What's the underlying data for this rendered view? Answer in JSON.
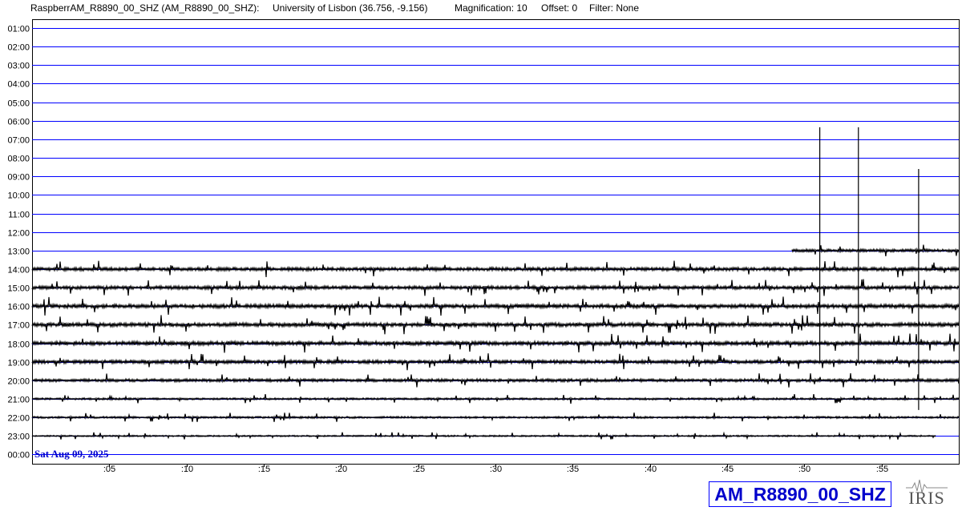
{
  "header": {
    "station": "RaspberrAM_R8890_00_SHZ (AM_R8890_00_SHZ):",
    "location": "University of Lisbon (36.756, -9.156)",
    "magnification": "Magnification: 10",
    "offset": "Offset: 0",
    "filter": "Filter: None"
  },
  "date_label": "Sat Aug 09, 2025",
  "station_code": "AM_R8890_00_SHZ",
  "logo_text": "IRIS",
  "colors": {
    "grid": "#0000ff",
    "trace": "#000000",
    "label": "#0000cc",
    "axis_text": "#000000"
  },
  "chart_data": {
    "type": "line",
    "title": "",
    "xlabel": "",
    "ylabel": "",
    "rows": [
      "01:00",
      "02:00",
      "03:00",
      "04:00",
      "05:00",
      "06:00",
      "07:00",
      "08:00",
      "09:00",
      "10:00",
      "11:00",
      "12:00",
      "13:00",
      "14:00",
      "15:00",
      "16:00",
      "17:00",
      "18:00",
      "19:00",
      "20:00",
      "21:00",
      "22:00",
      "23:00",
      "00:00"
    ],
    "x_ticks": [
      ":05",
      ":10",
      ":15",
      ":20",
      ":25",
      ":30",
      ":35",
      ":40",
      ":45",
      ":50",
      ":55"
    ],
    "x_tick_minutes": [
      5,
      10,
      15,
      20,
      25,
      30,
      35,
      40,
      45,
      50,
      55
    ],
    "xlim": [
      0,
      60
    ],
    "traces": [
      {
        "row": "13:00",
        "start_min": 49.2,
        "end_min": 60,
        "amplitude": 0.3
      },
      {
        "row": "14:00",
        "start_min": 0,
        "end_min": 60,
        "amplitude": 0.35
      },
      {
        "row": "15:00",
        "start_min": 0,
        "end_min": 60,
        "amplitude": 0.35
      },
      {
        "row": "16:00",
        "start_min": 0,
        "end_min": 60,
        "amplitude": 0.4
      },
      {
        "row": "17:00",
        "start_min": 0,
        "end_min": 60,
        "amplitude": 0.4
      },
      {
        "row": "18:00",
        "start_min": 0,
        "end_min": 60,
        "amplitude": 0.4
      },
      {
        "row": "19:00",
        "start_min": 0,
        "end_min": 60,
        "amplitude": 0.35
      },
      {
        "row": "20:00",
        "start_min": 0,
        "end_min": 60,
        "amplitude": 0.3
      },
      {
        "row": "21:00",
        "start_min": 0,
        "end_min": 60,
        "amplitude": 0.2
      },
      {
        "row": "22:00",
        "start_min": 0,
        "end_min": 60,
        "amplitude": 0.2
      },
      {
        "row": "23:00",
        "start_min": 0,
        "end_min": 58.5,
        "amplitude": 0.15
      }
    ],
    "spikes": [
      {
        "row": "13:00",
        "minute": 51.0,
        "top_row_value": 6.35,
        "bottom_row_value": 19.0
      },
      {
        "row": "13:00",
        "minute": 53.5,
        "top_row_value": 6.35,
        "bottom_row_value": 19.0
      },
      {
        "row": "13:00",
        "minute": 57.4,
        "top_row_value": 8.6,
        "bottom_row_value": 21.6
      }
    ]
  }
}
